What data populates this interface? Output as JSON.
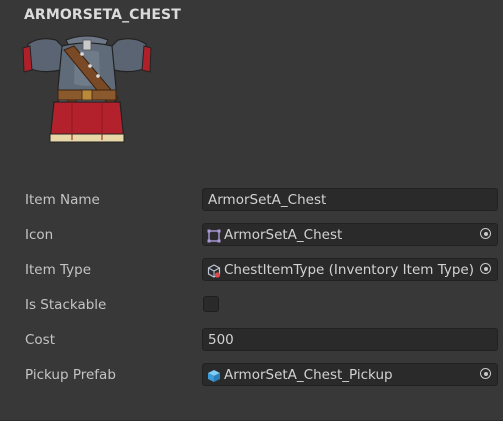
{
  "asset": {
    "title": "ARMORSETA_CHEST",
    "preview_icon": "chest-armor-icon"
  },
  "fields": {
    "item_name": {
      "label": "Item Name",
      "value": "ArmorSetA_Chest"
    },
    "icon": {
      "label": "Icon",
      "value": "ArmorSetA_Chest",
      "icon": "sprite-icon"
    },
    "item_type": {
      "label": "Item Type",
      "value": "ChestItemType (Inventory Item Type)",
      "icon": "scriptable-object-icon"
    },
    "is_stackable": {
      "label": "Is Stackable",
      "checked": false
    },
    "cost": {
      "label": "Cost",
      "value": "500"
    },
    "pickup_prefab": {
      "label": "Pickup Prefab",
      "value": "ArmorSetA_Chest_Pickup",
      "icon": "prefab-icon"
    }
  },
  "colors": {
    "background": "#383838",
    "field_background": "#2a2a2a",
    "text": "#c4c4c4",
    "prefab_blue": "#4fb3ea"
  }
}
